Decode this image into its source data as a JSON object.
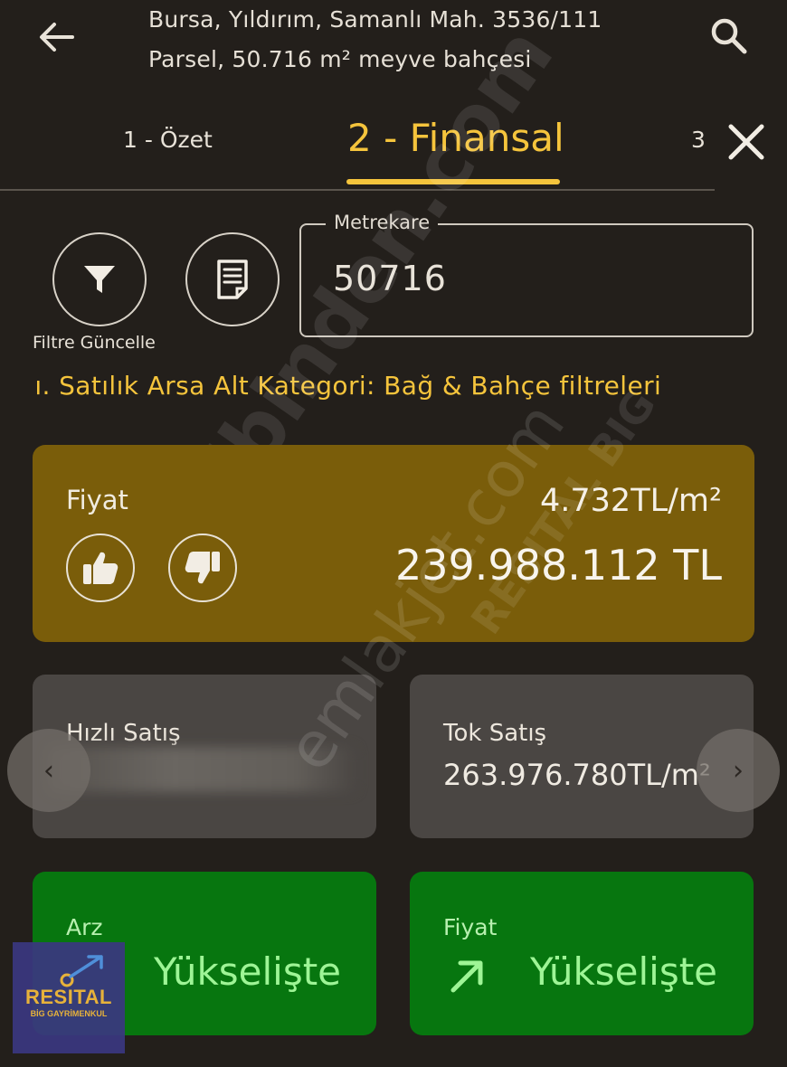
{
  "header": {
    "title_line1": "Bursa, Yıldırım, Samanlı Mah. 3536/111",
    "title_line2": "Parsel, 50.716 m² meyve bahçesi",
    "back_icon": "arrow-left-icon",
    "search_icon": "search-icon"
  },
  "tabs": {
    "tab1": "1 - Özet",
    "tab2": "2 - Finansal",
    "tab3": "3 - ",
    "active": "2 - Finansal",
    "close_icon": "close-icon"
  },
  "tools": {
    "filter_label": "Filtre Güncelle",
    "filter_icon": "funnel-icon",
    "document_icon": "document-icon"
  },
  "field": {
    "legend": "Metrekare",
    "value": "50716"
  },
  "marquee": {
    "text": "ıdı. Satılık Arsa Alt Kategori: Bağ & Bahçe filtreleri"
  },
  "price_card": {
    "label": "Fiyat",
    "per_m2": "4.732TL/m²",
    "total": "239.988.112 TL",
    "like_icon": "thumbs-up-icon",
    "dislike_icon": "thumbs-down-icon",
    "color": "#7a5d0a"
  },
  "quick_sale": {
    "label": "Hızlı Satış"
  },
  "bulk_sale": {
    "label": "Tok Satış",
    "value": "263.976.780TL/m²"
  },
  "trends": {
    "supply_label": "Arz",
    "supply_value": "Yükselişte",
    "price_label": "Fiyat",
    "price_value": "Yükselişte",
    "trend_icon": "arrow-up-right-icon",
    "color": "#07760f"
  },
  "carousel": {
    "prev": "‹",
    "next": "›"
  },
  "watermarks": {
    "w1": "sahibinden.com",
    "w2": "emlakjet.com",
    "w3": "RESITAL BIG"
  },
  "logo": {
    "name": "RESITAL",
    "sub": "BİG GAYRİMENKUL"
  }
}
